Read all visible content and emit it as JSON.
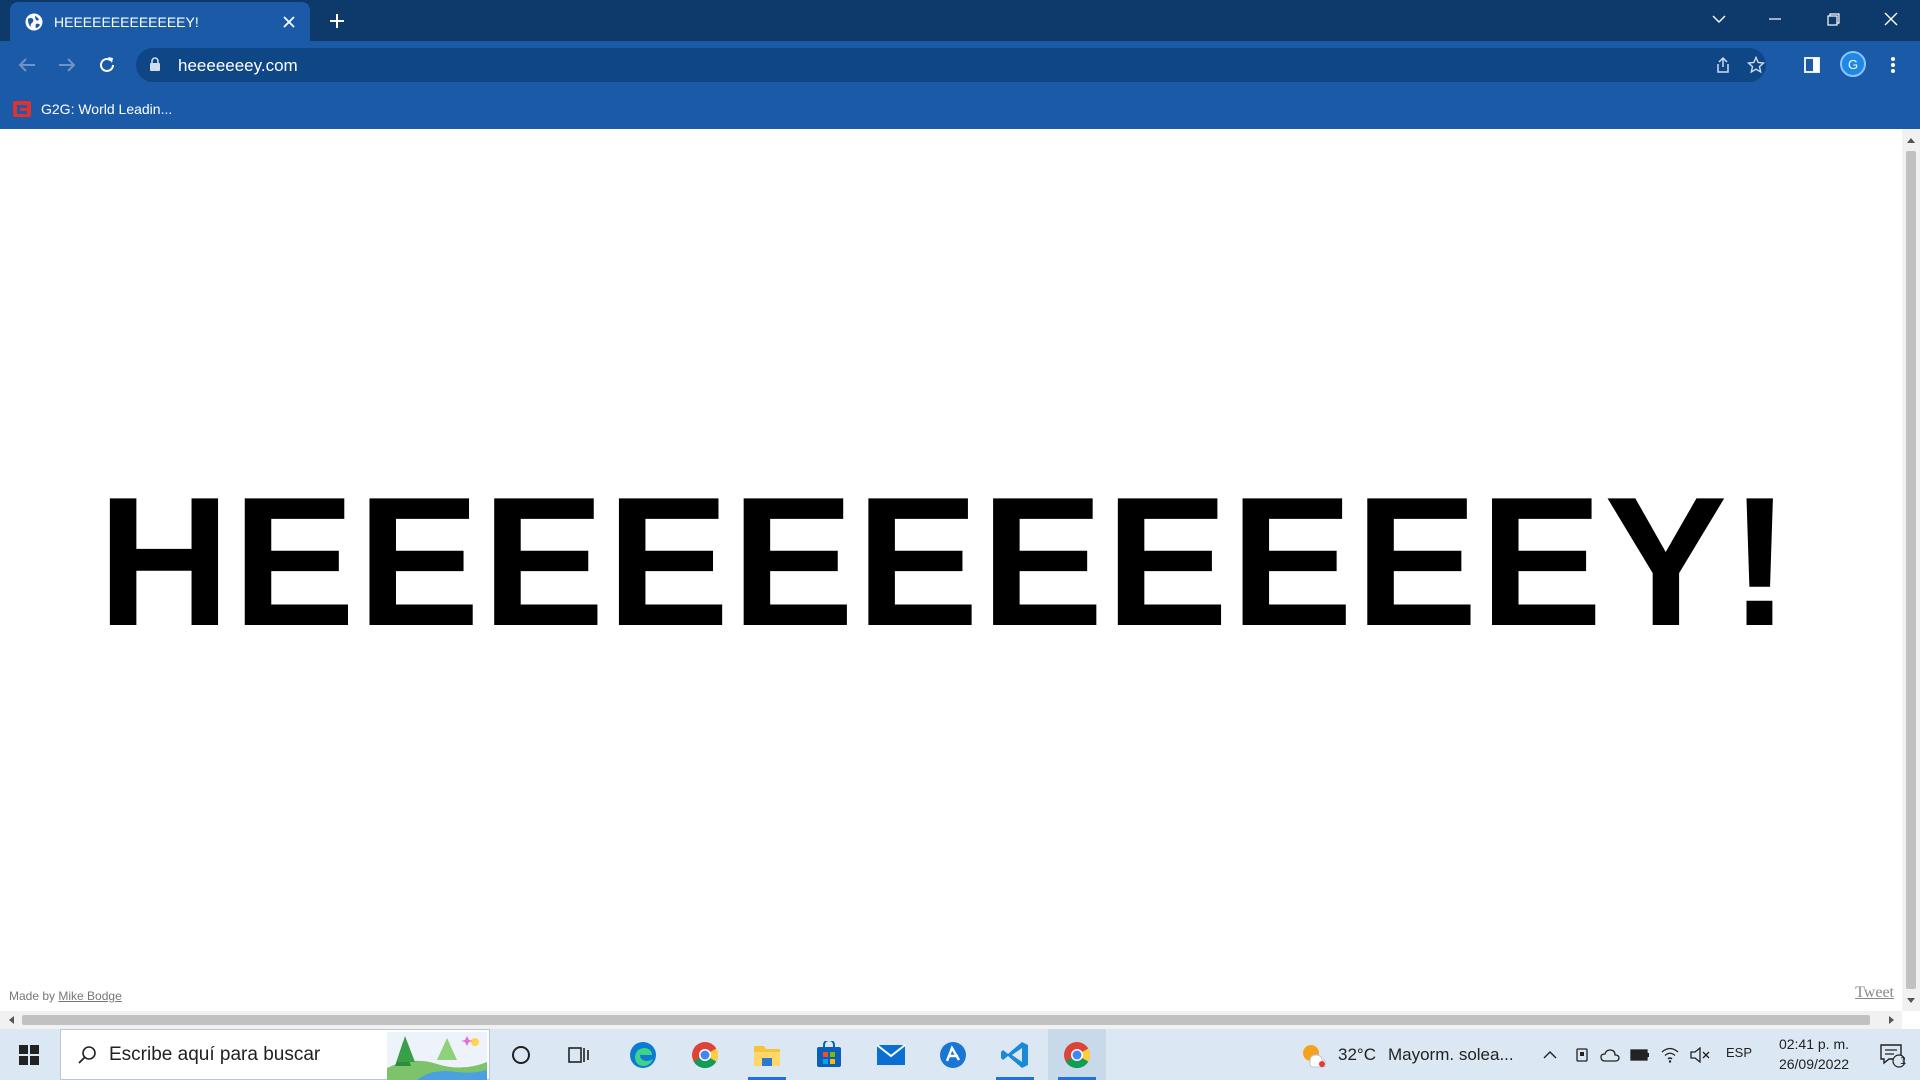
{
  "browser": {
    "tab": {
      "title": "HEEEEEEEEEEEEEY!"
    },
    "url": "heeeeeeey.com",
    "profile_initial": "G",
    "bookmark": {
      "label": "G2G: World Leadin..."
    }
  },
  "page": {
    "headline": "HEEEEEEEEEEEY!",
    "made_by_prefix": "Made by",
    "author_link": "Mike Bodge",
    "tweet_link": "Tweet"
  },
  "taskbar": {
    "search_placeholder": "Escribe aquí para buscar",
    "weather_temp": "32°C",
    "weather_desc": "Mayorm. solea...",
    "language": "ESP",
    "time": "02:41 p. m.",
    "date": "26/09/2022",
    "notification_count": "1"
  },
  "colors": {
    "tab_strip": "#0e3a6b",
    "toolbar": "#1a5aa6",
    "omnibox": "#0f4685",
    "taskbar": "#dbe7f3"
  },
  "icons": [
    "globe-icon",
    "close-icon",
    "plus-icon",
    "chevron-down-icon",
    "minimize-icon",
    "restore-icon",
    "back-icon",
    "forward-icon",
    "reload-icon",
    "lock-icon",
    "share-icon",
    "star-icon",
    "side-panel-icon",
    "menu-icon",
    "windows-icon",
    "search-icon",
    "cortana-icon",
    "task-view-icon",
    "edge-icon",
    "chrome-icon",
    "folder-icon",
    "store-icon",
    "mail-icon",
    "copilot-icon",
    "vscode-icon",
    "weather-icon",
    "wifi-icon",
    "volume-mute-icon",
    "notification-icon"
  ]
}
